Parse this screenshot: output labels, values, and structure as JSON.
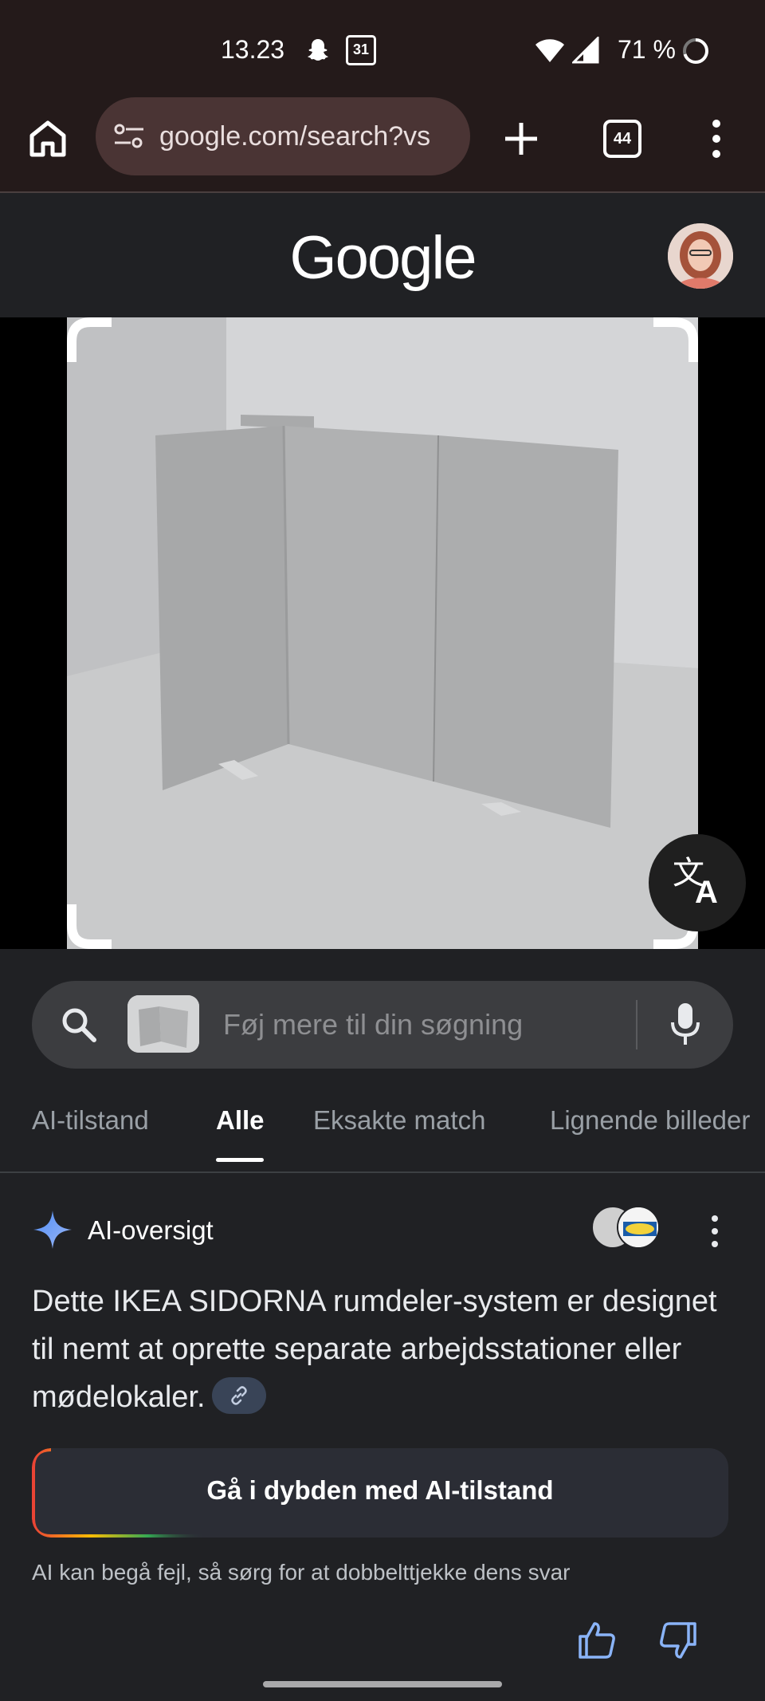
{
  "status_bar": {
    "time": "13.23",
    "calendar_day": "31",
    "battery": "71 %"
  },
  "browser": {
    "url": "google.com/search?vs",
    "tab_count": "44"
  },
  "header": {
    "logo": "Google"
  },
  "search": {
    "placeholder": "Føj mere til din søgning"
  },
  "tabs": [
    {
      "label": "AI-tilstand",
      "active": false
    },
    {
      "label": "Alle",
      "active": true
    },
    {
      "label": "Eksakte match",
      "active": false
    },
    {
      "label": "Lignende billeder",
      "active": false
    }
  ],
  "ai_overview": {
    "title": "AI-oversigt",
    "body": "Dette IKEA SIDORNA rumdeler-system er designet til nemt at oprette separate arbejdsstationer eller mødelokaler.",
    "deep_dive_button": "Gå i dybden med AI-tilstand",
    "disclaimer": "AI kan begå fejl, så sørg for at dobbelttjekke dens svar"
  },
  "icons": {
    "status": [
      "snapchat-icon",
      "calendar-icon",
      "wifi-icon",
      "signal-icon",
      "battery-icon"
    ],
    "browser": [
      "home-icon",
      "tune-icon",
      "plus-icon",
      "tabs-icon",
      "more-vert-icon"
    ],
    "search": [
      "search-icon",
      "mic-icon"
    ],
    "ai": [
      "sparkle-icon",
      "link-icon",
      "thumb-up-icon",
      "thumb-down-icon"
    ]
  },
  "colors": {
    "background": "#202124",
    "browser_chrome": "#241a1a",
    "url_pill": "#4a3434",
    "search_box": "#3c3d40",
    "ai_button": "#2b2d35",
    "accent_blue": "#8ab4f8"
  }
}
